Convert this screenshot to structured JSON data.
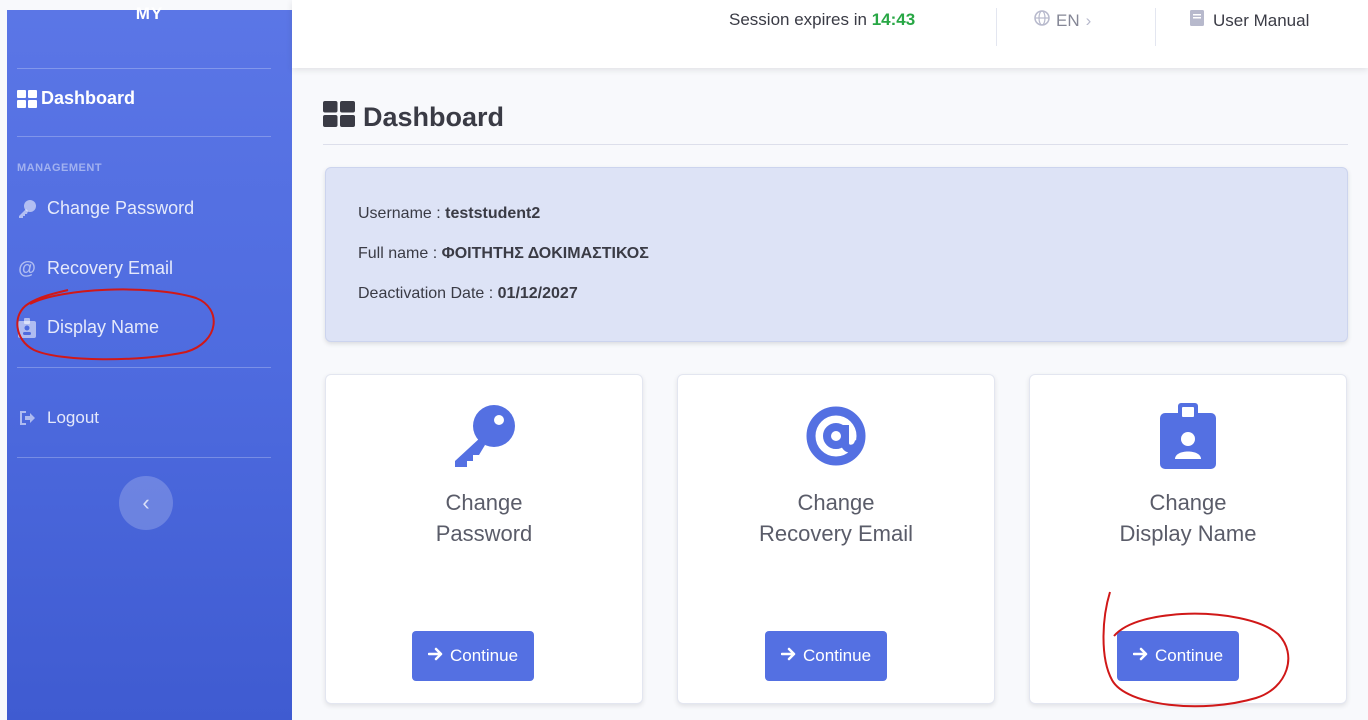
{
  "sidebar": {
    "brand": "MY",
    "items": [
      {
        "label": "Dashboard",
        "icon": "dashboard-icon",
        "active": true
      },
      {
        "label": "Change Password",
        "icon": "key-icon"
      },
      {
        "label": "Recovery Email",
        "icon": "at-icon"
      },
      {
        "label": "Display Name",
        "icon": "id-badge-icon"
      },
      {
        "label": "Logout",
        "icon": "logout-icon"
      }
    ],
    "heading": "MANAGEMENT",
    "toggle": "‹"
  },
  "topbar": {
    "session_label": "Session expires in",
    "session_time": "14:43",
    "language": "EN",
    "language_arrow": "›",
    "manual": "User Manual"
  },
  "main": {
    "title": "Dashboard",
    "info": {
      "username_label": "Username :",
      "username": "teststudent2",
      "fullname_label": "Full name :",
      "fullname": "ΦΟΙΤΗΤΗΣ ΔΟΚΙΜΑΣΤΙΚΟΣ",
      "deactivation_label": "Deactivation Date :",
      "deactivation": "01/12/2027"
    },
    "cards": [
      {
        "line1": "Change",
        "line2": "Password",
        "icon": "key-icon",
        "button": "Continue"
      },
      {
        "line1": "Change",
        "line2": "Recovery Email",
        "icon": "at-icon",
        "button": "Continue"
      },
      {
        "line1": "Change",
        "line2": "Display Name",
        "icon": "id-badge-icon",
        "button": "Continue"
      }
    ]
  },
  "colors": {
    "sidebar": "#4e6bdf",
    "primary_button": "#5470e2",
    "session_time": "#28a745",
    "annotation": "#d01818"
  }
}
